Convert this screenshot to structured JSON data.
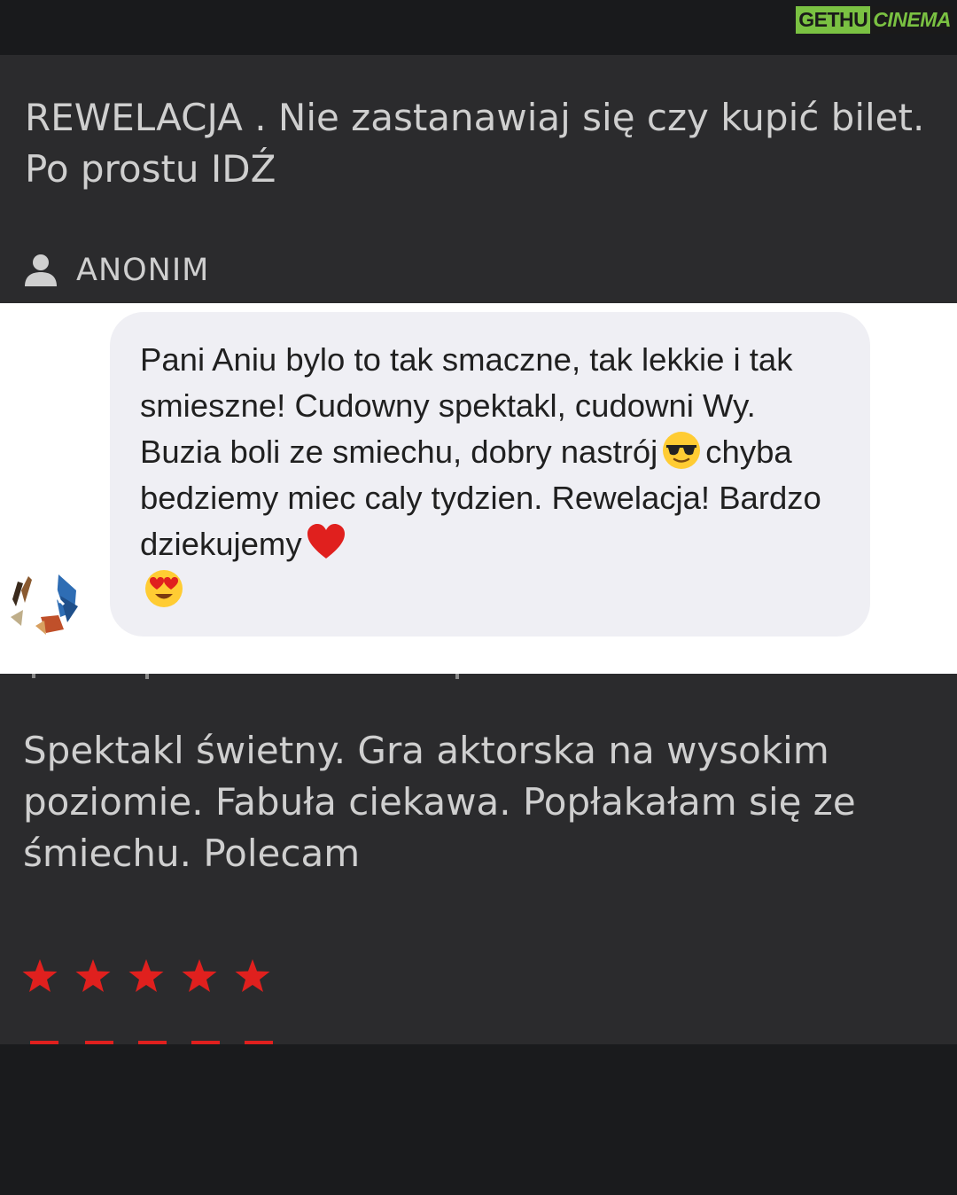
{
  "watermark": {
    "part1": "GETHU",
    "part2": "CINEMA"
  },
  "review_top": {
    "text": "REWELACJA . Nie zastanawiaj się czy kupić bilet. Po prostu IDŹ",
    "author": "ANONIM",
    "author_icon": "person-icon"
  },
  "message": {
    "line1": "Pani Aniu bylo to tak smaczne, tak lekkie i tak smieszne! Cudowny spektakl, cudowni Wy. Buzia boli ze smiechu, dobry nastrój",
    "line2": "chyba bedziemy miec caly tydzien. Rewelacja! Bardzo dziekujemy",
    "emojis": [
      "sunglasses-emoji",
      "red-heart-emoji",
      "heart-eyes-emoji"
    ]
  },
  "review_bottom": {
    "text": "Spektakl świetny. Gra aktorska na wysokim poziomie. Fabuła ciekawa. Popłakałam się ze śmiechu. Polecam",
    "rating": 5,
    "star_color": "#e0201e"
  },
  "colors": {
    "panel": "#2b2b2d",
    "bar": "#1a1b1d",
    "text": "#cfcfcf",
    "bubble": "#efeff4",
    "watermark_green": "#7ac142"
  }
}
